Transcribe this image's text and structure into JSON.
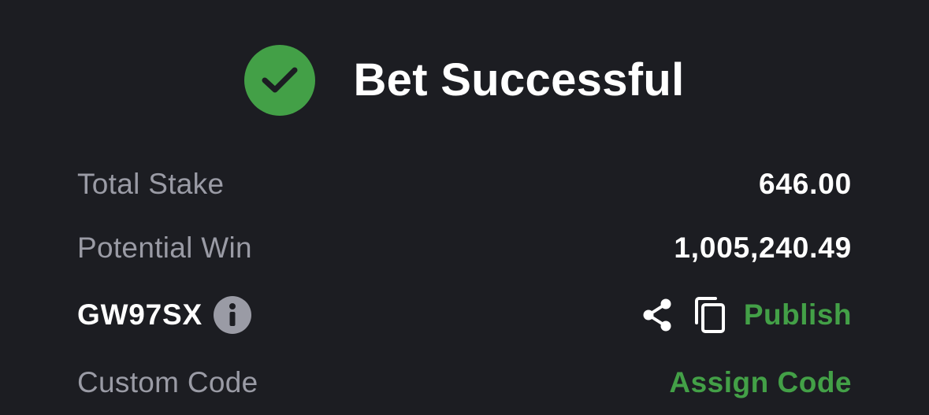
{
  "header": {
    "title": "Bet Successful",
    "icon": "check-circle-icon",
    "accent_color": "#43a047"
  },
  "summary": {
    "total_stake_label": "Total Stake",
    "total_stake_value": "646.00",
    "potential_win_label": "Potential Win",
    "potential_win_value": "1,005,240.49"
  },
  "booking": {
    "code": "GW97SX",
    "info_icon": "info-icon",
    "share_icon": "share-icon",
    "copy_icon": "copy-icon",
    "publish_label": "Publish"
  },
  "custom_code": {
    "label": "Custom Code",
    "action_label": "Assign Code"
  }
}
